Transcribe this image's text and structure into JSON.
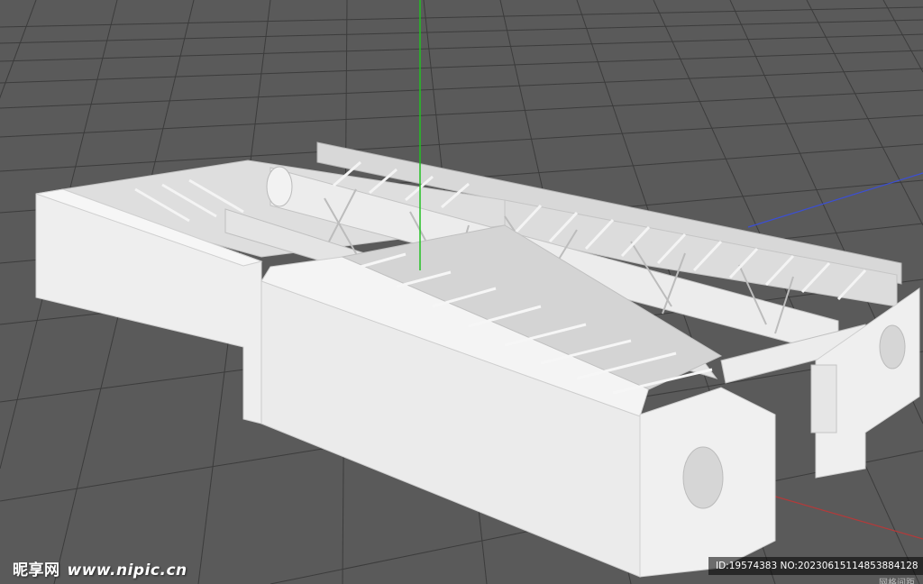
{
  "watermark": {
    "brand": "昵享网",
    "url": "www.nipic.cn"
  },
  "image_id": "ID:19574383 NO:20230615114853884128",
  "viewport": {
    "grid_label": "网格间距",
    "colors": {
      "background": "#5a5a5a",
      "grid": "#3d3d3d",
      "axis_y": "#22c022",
      "axis_z": "#3b4fd6",
      "axis_x": "#b43a3a",
      "model": "#e6e6e6"
    }
  }
}
